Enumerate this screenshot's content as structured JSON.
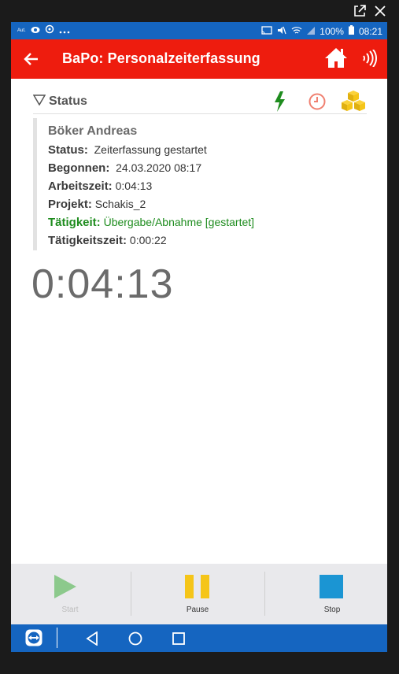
{
  "statusbar": {
    "left_text": "Aut.",
    "battery": "100%",
    "time": "08:21"
  },
  "appbar": {
    "title": "BaPo: Personalzeiterfassung",
    "icons": [
      "back-arrow-icon",
      "home-icon",
      "nfc-icon"
    ]
  },
  "section": {
    "title": "Status",
    "icons": [
      "lightning-icon",
      "clock-icon",
      "boxes-icon"
    ]
  },
  "info": {
    "name": "Böker Andreas",
    "status_label": "Status:",
    "status_value": "Zeiterfassung gestartet",
    "started_label": "Begonnen:",
    "started_value": "24.03.2020 08:17",
    "worktime_label": "Arbeitszeit:",
    "worktime_value": "0:04:13",
    "project_label": "Projekt:",
    "project_value": "Schakis_2",
    "activity_label": "Tätigkeit:",
    "activity_value": "Übergabe/Abnahme [gestartet]",
    "activitytime_label": "Tätigkeitszeit:",
    "activitytime_value": "0:00:22"
  },
  "timer": "0:04:13",
  "toolbar": {
    "start": "Start",
    "pause": "Pause",
    "stop": "Stop"
  },
  "colors": {
    "appbar": "#ee1c0e",
    "statusbar": "#1565c0",
    "start": "#8cc98c",
    "pause": "#f5c518",
    "stop": "#1b95d3",
    "green": "#1e8c1e"
  }
}
